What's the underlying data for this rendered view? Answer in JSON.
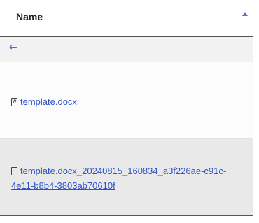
{
  "header": {
    "name_label": "Name",
    "sort_direction": "ascending"
  },
  "back_row": {
    "icon": "back-arrow-icon",
    "glyph": "←"
  },
  "files": [
    {
      "name": "template.docx",
      "icon": "word-document-icon",
      "icon_letter": "W"
    },
    {
      "name": "template.docx_20240815_160834_a3f226ae-c91c-4e11-b8b4-3803ab70610f",
      "icon": "generic-file-icon"
    }
  ],
  "colors": {
    "link": "#2f54c7",
    "sort_indicator": "#6b66c9",
    "back_arrow": "#4a6fd8",
    "selected_row": "#e9e9e9"
  }
}
